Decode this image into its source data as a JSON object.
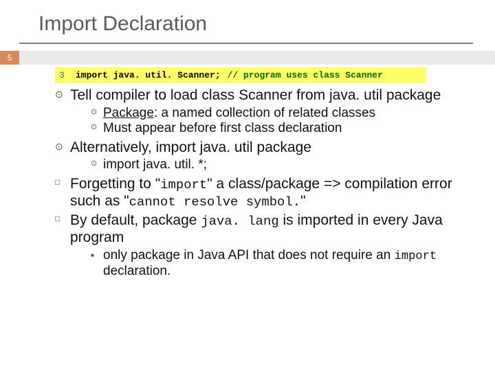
{
  "slide": {
    "title": "Import Declaration",
    "page_number": "5"
  },
  "code": {
    "lineno": "3",
    "stmt": "import java. util. Scanner;",
    "comment": "// program uses class Scanner"
  },
  "b1": {
    "text": "Tell compiler to load class Scanner from java. util package",
    "sub1_pre": "Package",
    "sub1_post": ": a named collection of related classes",
    "sub2": "Must appear before first class declaration"
  },
  "b2": {
    "text": "Alternatively, import java. util package",
    "sub1": "import java. util. *;"
  },
  "b3": {
    "pre": "Forgetting to \"",
    "code1": "import",
    "mid": "\" a class/package => compilation error such as \"",
    "code2": "cannot resolve symbol.",
    "post": "\""
  },
  "b4": {
    "pre": "By default, package ",
    "code1": "java. lang",
    "post": " is imported in every Java program",
    "sub1_pre": "only package in Java API that does not require an ",
    "sub1_code": "import",
    "sub1_post": " declaration."
  }
}
